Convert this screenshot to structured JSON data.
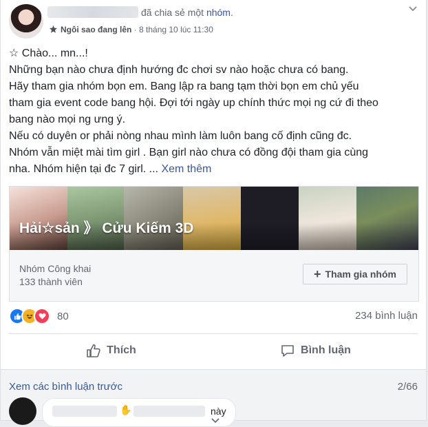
{
  "post": {
    "shared_text": "đã chia sẻ một",
    "shared_link": "nhóm",
    "shared_end": ".",
    "badge": "Ngôi sao đang lên",
    "separator": " · ",
    "timestamp": "8 tháng 10 lúc 11:30",
    "lines": [
      "☆ Chào... mn...!",
      "Những bạn nào chưa định hướng đc chơi sv nào hoặc chưa có bang.",
      "Hãy tham gia nhóm bọn em. Bang lập ra bang tạm thời bọn em chủ yếu",
      "tham gia event code bang hội. Đợi tới ngày up chính thức mọi ng cứ đi theo",
      "bang nào mọi ng ưng ý.",
      "Nếu có duyên or phải nòng nhau mình làm luôn bang cố định cũng đc.",
      "Nhóm vẫn miệt mài tìm girl . Bạn girl nào chưa có đồng đội tham gia cùng"
    ],
    "last_line": "nha. Nhóm hiện tại đc 7 girl. ...",
    "see_more": "Xem thêm"
  },
  "group": {
    "cover_title": "Hải☆sản 》 Cửu Kiếm 3D",
    "type": "Nhóm Công khai",
    "members": "133 thành viên",
    "join_label": "Tham gia nhóm"
  },
  "stats": {
    "reaction_count": "80",
    "comment_count": "234 bình luận",
    "reactions": [
      "like",
      "haha",
      "love"
    ]
  },
  "actions": {
    "like_label": "Thích",
    "comment_label": "Bình luận"
  },
  "comments": {
    "view_previous": "Xem các bình luận trước",
    "pager": "2/66",
    "first_text": "này"
  },
  "colors": {
    "link": "#385898",
    "like": "#1877f2",
    "love": "#f33e58",
    "haha": "#f7b125"
  }
}
